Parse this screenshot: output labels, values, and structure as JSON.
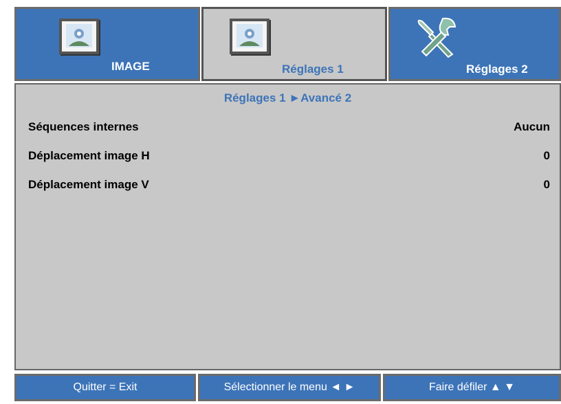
{
  "tabs": [
    {
      "label": "IMAGE",
      "icon": "picture-icon",
      "active": false
    },
    {
      "label": "Réglages 1",
      "icon": "picture-icon",
      "active": true
    },
    {
      "label": "Réglages 2",
      "icon": "tools-icon",
      "active": false
    }
  ],
  "breadcrumb": "Réglages 1 ►Avancé 2",
  "settings": [
    {
      "label": "Séquences internes",
      "value": "Aucun"
    },
    {
      "label": "Déplacement image H",
      "value": "0"
    },
    {
      "label": "Déplacement image V",
      "value": "0"
    }
  ],
  "footer": {
    "exit": "Quitter = Exit",
    "select": "Sélectionner le menu ◄ ►",
    "scroll": "Faire défiler ▲ ▼"
  },
  "colors": {
    "accent": "#3d74b8",
    "panel": "#c8c8c8",
    "border": "#6b6b6b"
  }
}
